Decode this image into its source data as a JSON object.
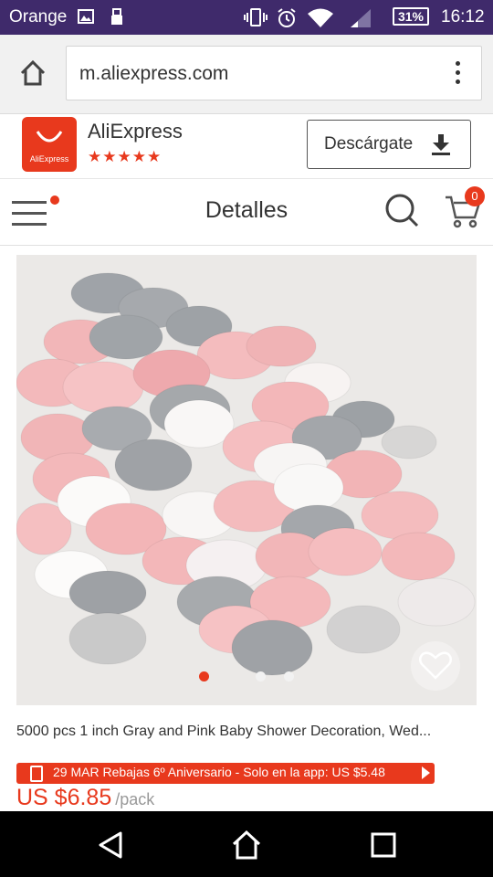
{
  "status_bar": {
    "carrier": "Orange",
    "battery": "31%",
    "time": "16:12",
    "icons": [
      "image-icon",
      "usb-icon",
      "vibrate-icon",
      "alarm-icon",
      "wifi-icon",
      "signal-icon",
      "battery-icon"
    ]
  },
  "browser": {
    "url": "m.aliexpress.com",
    "icons": [
      "home-icon",
      "more-vert-icon"
    ]
  },
  "app_banner": {
    "app_name": "AliExpress",
    "logo_text": "AliExpress",
    "rating_stars": 4.5,
    "rating_glyphs": "★★★★",
    "download_label": "Descárgate",
    "icons": [
      "download-icon"
    ]
  },
  "header": {
    "title": "Detalles",
    "cart_count": "0",
    "icons": [
      "menu-icon",
      "search-icon",
      "cart-icon"
    ]
  },
  "product": {
    "image_dots": 3,
    "active_dot": 0,
    "title": "5000 pcs 1 inch Gray and Pink Baby Shower Decoration, Wed...",
    "promo": "29 MAR Rebajas 6º Aniversario - Solo en la app: US $5.48",
    "price": "US $6.85",
    "price_unit": "/pack",
    "icons": [
      "heart-icon",
      "phone-icon"
    ]
  },
  "colors": {
    "accent": "#e8391d",
    "status_bar": "#3f2a6b"
  },
  "system_nav": {
    "icons": [
      "back-icon",
      "home-icon",
      "recents-icon"
    ]
  }
}
